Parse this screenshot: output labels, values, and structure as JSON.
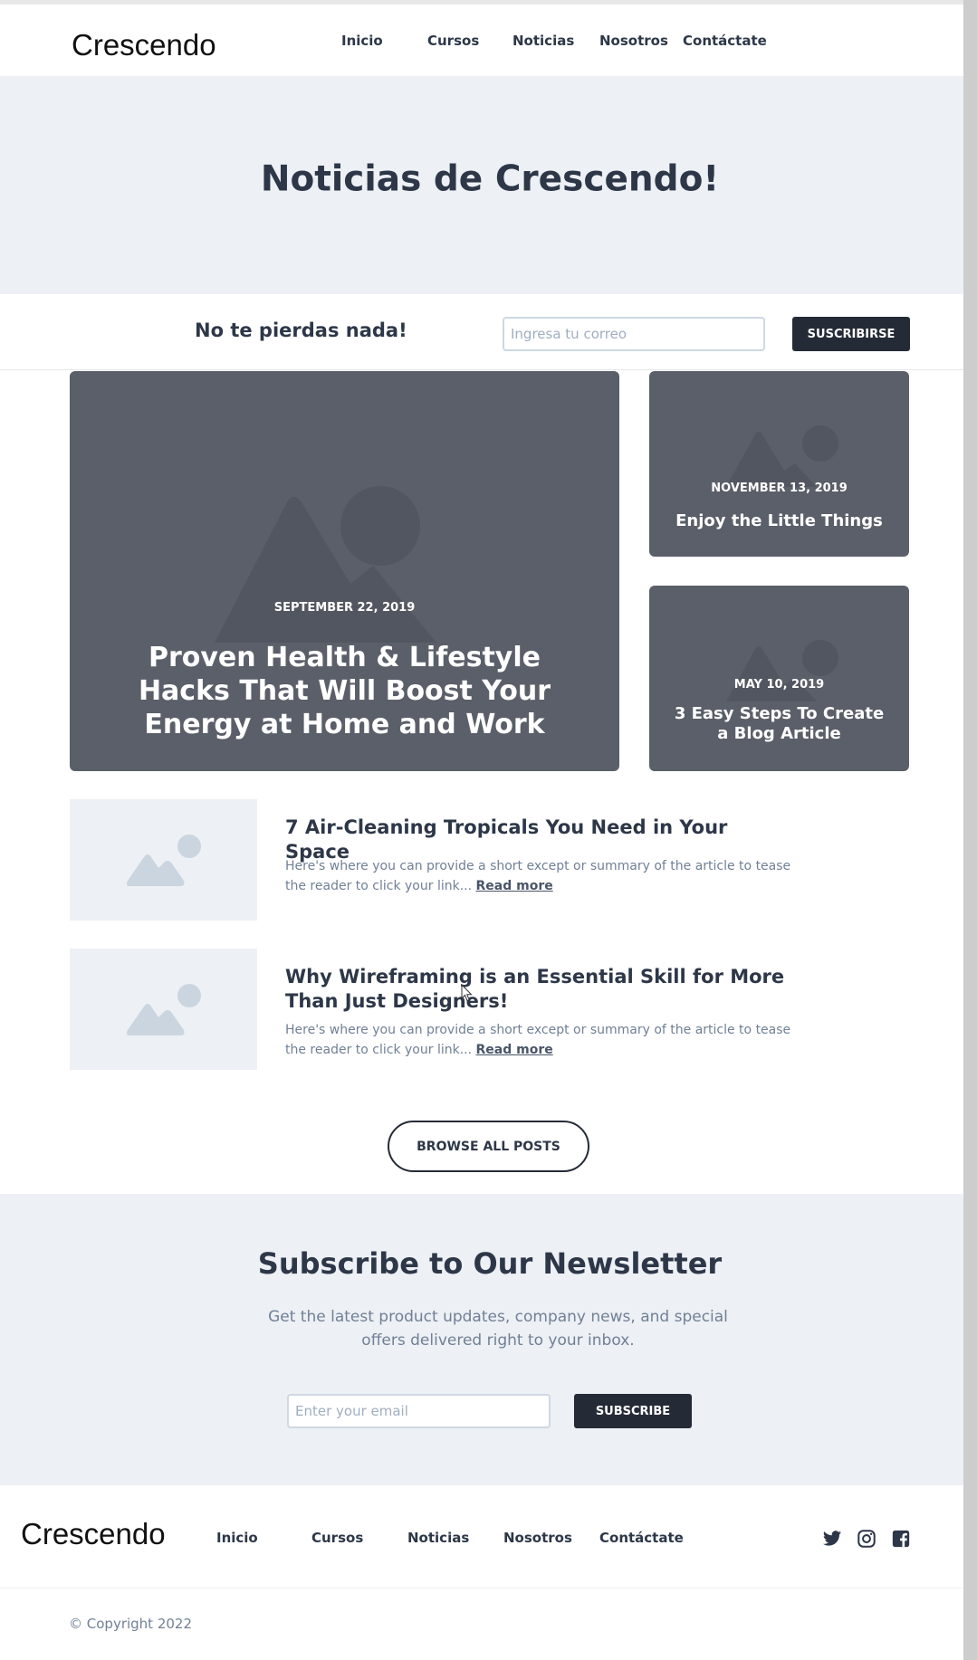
{
  "brand": "Crescendo",
  "nav": [
    "Inicio",
    "Cursos",
    "Noticias",
    "Nosotros",
    "Contáctate"
  ],
  "hero": {
    "title": "Noticias de Crescendo!"
  },
  "strip": {
    "title": "No te pierdas nada!",
    "placeholder": "Ingresa tu correo",
    "button": "SUSCRIBIRSE"
  },
  "featured": {
    "main": {
      "date": "SEPTEMBER 22, 2019",
      "title": "Proven Health & Lifestyle Hacks That Will Boost Your Energy at Home and Work"
    },
    "side1": {
      "date": "NOVEMBER 13, 2019",
      "title": "Enjoy the Little Things"
    },
    "side2": {
      "date": "MAY 10, 2019",
      "title": "3 Easy Steps To Create a Blog Article"
    }
  },
  "posts": [
    {
      "title": "7 Air-Cleaning Tropicals You Need in Your Space",
      "excerpt": "Here's where you can provide a short except or summary of the article to tease the reader to click your link...",
      "read_more": "Read more"
    },
    {
      "title": "Why Wireframing is an Essential Skill for More Than Just Designers!",
      "excerpt": "Here's where you can provide a short except or summary of the article to tease the reader to click your link...",
      "read_more": "Read more"
    }
  ],
  "browse_button": "BROWSE ALL POSTS",
  "newsletter": {
    "title": "Subscribe to Our Newsletter",
    "text": "Get the latest product updates, company news, and special offers delivered right to your inbox.",
    "placeholder": "Enter your email",
    "button": "SUBSCRIBE"
  },
  "footer": {
    "brand": "Crescendo",
    "nav": [
      "Inicio",
      "Cursos",
      "Noticias",
      "Nosotros",
      "Contáctate"
    ],
    "social_icons": [
      "twitter-icon",
      "instagram-icon",
      "facebook-icon"
    ],
    "copyright": "© Copyright 2022"
  }
}
